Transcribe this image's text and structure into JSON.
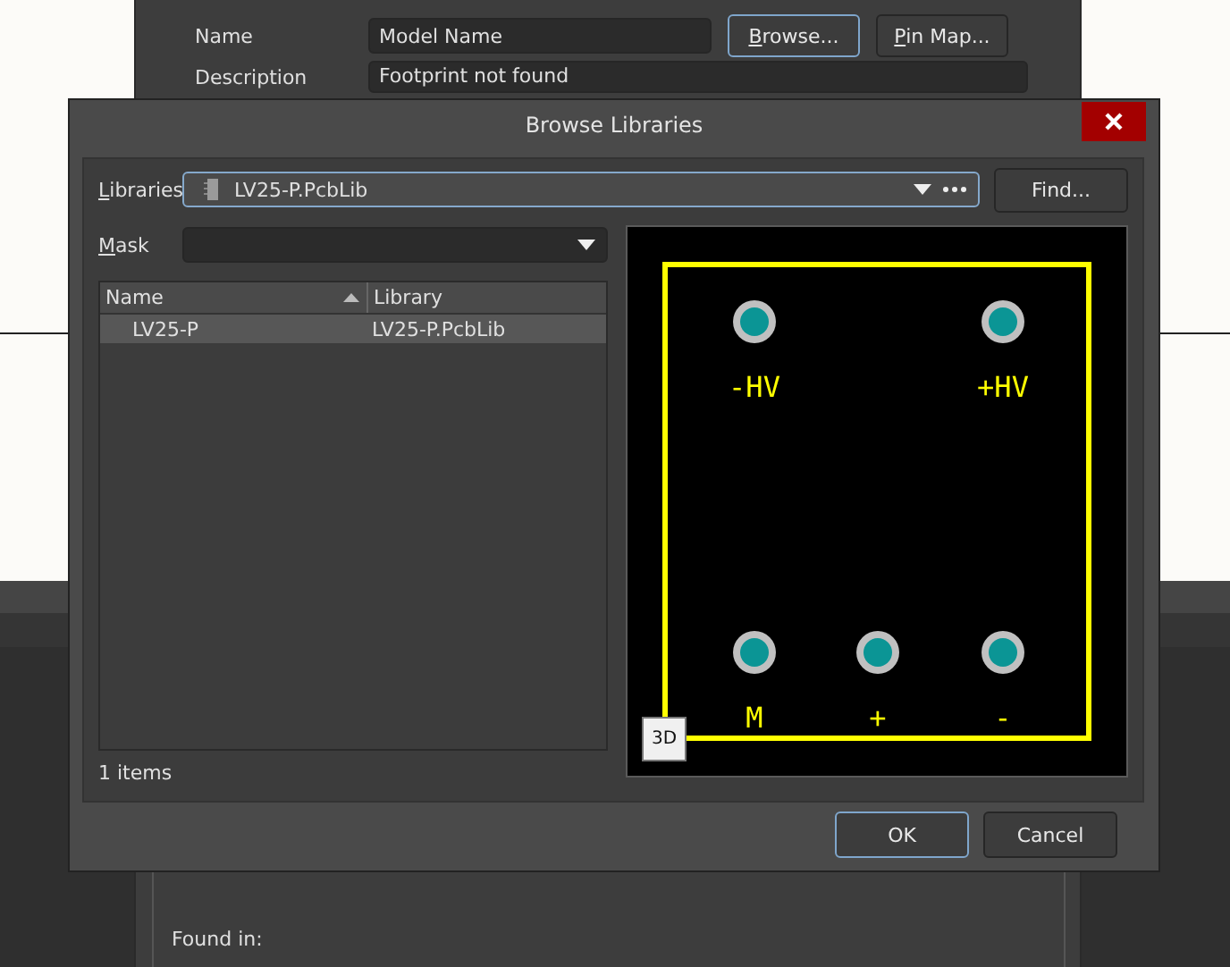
{
  "parent_dialog": {
    "fields": [
      {
        "label": "Name",
        "value": "Model Name"
      },
      {
        "label": "Description",
        "value": "Footprint not found"
      }
    ],
    "buttons": [
      {
        "label": "Browse...",
        "mnemonic": true,
        "focused": true
      },
      {
        "label": "Pin Map...",
        "mnemonic": true,
        "focused": false
      }
    ],
    "found_in_label": "Found in:"
  },
  "dialog": {
    "title": "Browse Libraries",
    "libraries": {
      "label": "Libraries",
      "mnemonic": true,
      "value": "LV25-P.PcbLib"
    },
    "find_button": "Find...",
    "mask": {
      "label": "Mask",
      "mnemonic": true
    },
    "table": {
      "columns": [
        {
          "label": "Name",
          "sorted": true
        },
        {
          "label": "Library",
          "sorted": false
        }
      ],
      "rows": [
        {
          "cells": [
            "LV25-P",
            "LV25-P.PcbLib"
          ],
          "selected": true
        }
      ]
    },
    "item_count": "1 items",
    "preview": {
      "pins": [
        {
          "label": "-HV"
        },
        {
          "label": "+HV"
        },
        {
          "label": "M"
        },
        {
          "label": "+"
        },
        {
          "label": "-"
        }
      ],
      "view_button": "3D"
    },
    "buttons": [
      {
        "label": "OK",
        "focused": true
      },
      {
        "label": "Cancel",
        "focused": false
      }
    ]
  }
}
